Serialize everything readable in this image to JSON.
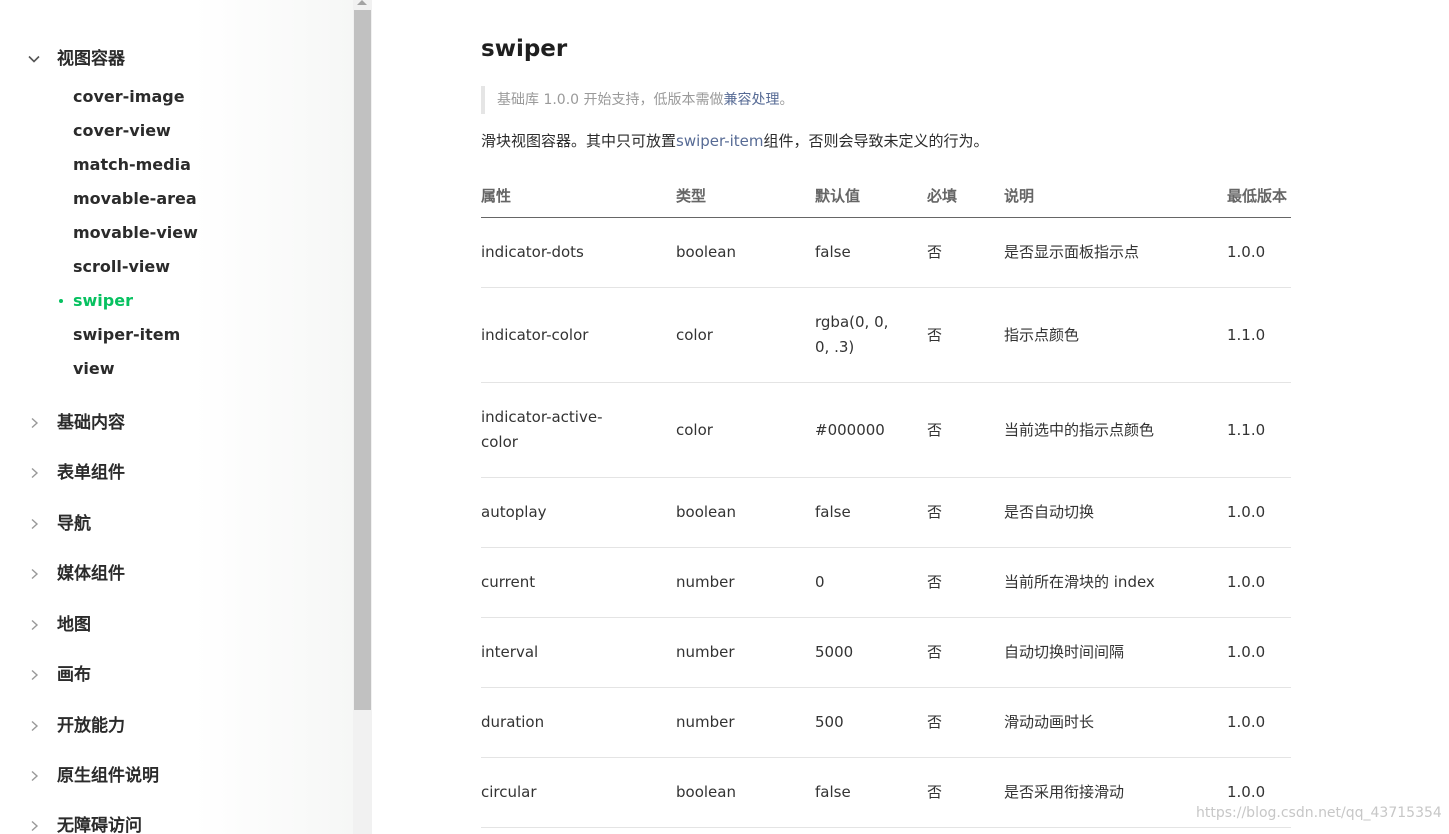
{
  "sidebar": {
    "groups": [
      {
        "label": "视图容器",
        "expanded": true,
        "items": [
          "cover-image",
          "cover-view",
          "match-media",
          "movable-area",
          "movable-view",
          "scroll-view",
          "swiper",
          "swiper-item",
          "view"
        ],
        "active_item": "swiper"
      },
      {
        "label": "基础内容",
        "expanded": false
      },
      {
        "label": "表单组件",
        "expanded": false
      },
      {
        "label": "导航",
        "expanded": false
      },
      {
        "label": "媒体组件",
        "expanded": false
      },
      {
        "label": "地图",
        "expanded": false
      },
      {
        "label": "画布",
        "expanded": false
      },
      {
        "label": "开放能力",
        "expanded": false
      },
      {
        "label": "原生组件说明",
        "expanded": false
      },
      {
        "label": "无障碍访问",
        "expanded": false
      }
    ]
  },
  "main": {
    "title": "swiper",
    "note": {
      "prefix": "基础库 1.0.0 开始支持，低版本需做",
      "link": "兼容处理",
      "suffix": "。"
    },
    "description": {
      "prefix": "滑块视图容器。其中只可放置",
      "link": "swiper-item",
      "suffix": "组件，否则会导致未定义的行为。"
    },
    "table": {
      "headers": [
        "属性",
        "类型",
        "默认值",
        "必填",
        "说明",
        "最低版本"
      ],
      "rows": [
        [
          "indicator-dots",
          "boolean",
          "false",
          "否",
          "是否显示面板指示点",
          "1.0.0"
        ],
        [
          "indicator-color",
          "color",
          "rgba(0, 0, 0, .3)",
          "否",
          "指示点颜色",
          "1.1.0"
        ],
        [
          "indicator-active-color",
          "color",
          "#000000",
          "否",
          "当前选中的指示点颜色",
          "1.1.0"
        ],
        [
          "autoplay",
          "boolean",
          "false",
          "否",
          "是否自动切换",
          "1.0.0"
        ],
        [
          "current",
          "number",
          "0",
          "否",
          "当前所在滑块的 index",
          "1.0.0"
        ],
        [
          "interval",
          "number",
          "5000",
          "否",
          "自动切换时间间隔",
          "1.0.0"
        ],
        [
          "duration",
          "number",
          "500",
          "否",
          "滑动动画时长",
          "1.0.0"
        ],
        [
          "circular",
          "boolean",
          "false",
          "否",
          "是否采用衔接滑动",
          "1.0.0"
        ]
      ]
    }
  },
  "watermark": "https://blog.csdn.net/qq_43715354",
  "colors": {
    "accent": "#07c160",
    "link": "#576b95"
  },
  "icons": {
    "expanded": "chevron-down-icon",
    "collapsed": "chevron-right-icon"
  }
}
